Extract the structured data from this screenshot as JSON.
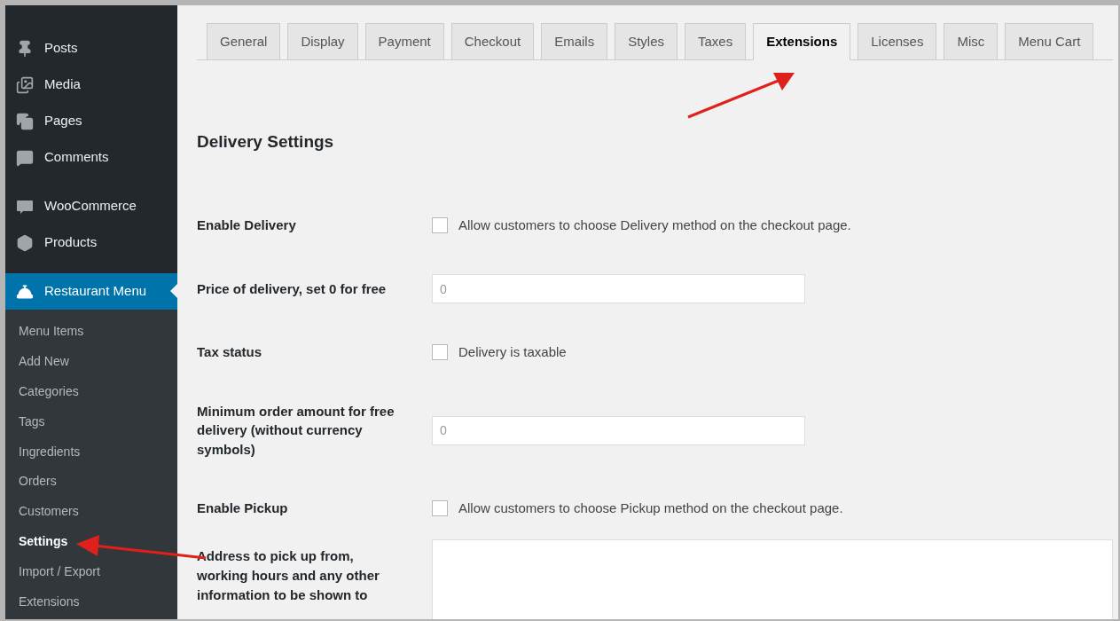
{
  "sidebar": {
    "items": [
      {
        "label": "Posts",
        "selected": false
      },
      {
        "label": "Media",
        "selected": false
      },
      {
        "label": "Pages",
        "selected": false
      },
      {
        "label": "Comments",
        "selected": false
      },
      {
        "label": "WooCommerce",
        "selected": false
      },
      {
        "label": "Products",
        "selected": false
      },
      {
        "label": "Restaurant Menu",
        "selected": true
      }
    ],
    "submenu": [
      {
        "label": "Menu Items",
        "selected": false
      },
      {
        "label": "Add New",
        "selected": false
      },
      {
        "label": "Categories",
        "selected": false
      },
      {
        "label": "Tags",
        "selected": false
      },
      {
        "label": "Ingredients",
        "selected": false
      },
      {
        "label": "Orders",
        "selected": false
      },
      {
        "label": "Customers",
        "selected": false
      },
      {
        "label": "Settings",
        "selected": true
      },
      {
        "label": "Import / Export",
        "selected": false
      },
      {
        "label": "Extensions",
        "selected": false
      }
    ]
  },
  "tabs": [
    {
      "label": "General",
      "selected": false
    },
    {
      "label": "Display",
      "selected": false
    },
    {
      "label": "Payment",
      "selected": false
    },
    {
      "label": "Checkout",
      "selected": false
    },
    {
      "label": "Emails",
      "selected": false
    },
    {
      "label": "Styles",
      "selected": false
    },
    {
      "label": "Taxes",
      "selected": false
    },
    {
      "label": "Extensions",
      "selected": true
    },
    {
      "label": "Licenses",
      "selected": false
    },
    {
      "label": "Misc",
      "selected": false
    },
    {
      "label": "Menu Cart",
      "selected": false
    }
  ],
  "section_title": "Delivery Settings",
  "fields": [
    {
      "label": "Enable Delivery",
      "kind": "checkbox",
      "checked": false,
      "text": "Allow customers to choose Delivery method on the checkout page."
    },
    {
      "label": "Price of delivery, set 0 for free",
      "kind": "input",
      "placeholder": "0"
    },
    {
      "label": "Tax status",
      "kind": "checkbox",
      "checked": false,
      "text": "Delivery is taxable"
    },
    {
      "label": "Minimum order amount for free delivery (without currency symbols)",
      "kind": "input",
      "placeholder": "0"
    },
    {
      "label": "Enable Pickup",
      "kind": "checkbox",
      "checked": false,
      "text": "Allow customers to choose Pickup method on the checkout page."
    },
    {
      "label": "Address to pick up from, working hours and any other information to be shown to",
      "kind": "textarea"
    }
  ]
}
